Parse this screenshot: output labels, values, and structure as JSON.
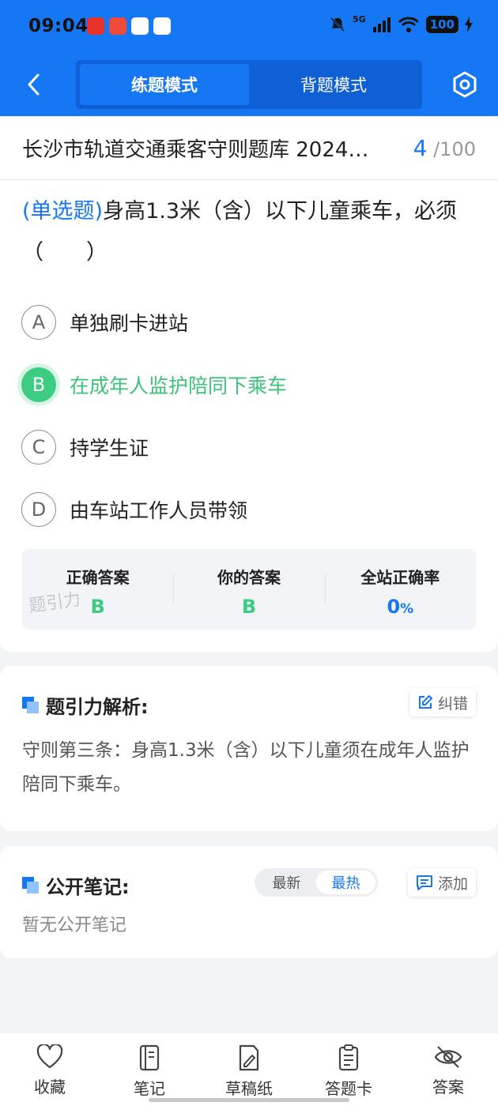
{
  "status_bar": {
    "time": "09:04",
    "network": "5G",
    "battery": "100"
  },
  "nav": {
    "modes": [
      "练题模式",
      "背题模式"
    ],
    "active_mode": "练题模式"
  },
  "question": {
    "bank_title": "长沙市轨道交通乘客守则题库 2024…",
    "current": "4",
    "total": "/100",
    "type_label": "(单选题)",
    "text": "身高1.3米（含）以下儿童乘车，必须（　　）",
    "options": [
      {
        "letter": "A",
        "text": "单独刷卡进站"
      },
      {
        "letter": "B",
        "text": "在成年人监护陪同下乘车"
      },
      {
        "letter": "C",
        "text": "持学生证"
      },
      {
        "letter": "D",
        "text": "由车站工作人员带领"
      }
    ],
    "selected": "B"
  },
  "answer": {
    "correct_label": "正确答案",
    "correct_value": "B",
    "yours_label": "你的答案",
    "yours_value": "B",
    "rate_label": "全站正确率",
    "rate_value": "0",
    "rate_unit": "%",
    "watermark": "题引力"
  },
  "analysis": {
    "title": "题引力解析:",
    "correct_btn": "纠错",
    "text": "守则第三条：身高1.3米（含）以下儿童须在成年人监护陪同下乘车。"
  },
  "notes": {
    "title": "公开笔记:",
    "sort_options": [
      "最新",
      "最热"
    ],
    "active_sort": "最热",
    "add_btn": "添加",
    "empty_text": "暂无公开笔记"
  },
  "bottom_bar": {
    "items": [
      {
        "label": "收藏",
        "icon": "heart-icon"
      },
      {
        "label": "笔记",
        "icon": "notebook-icon"
      },
      {
        "label": "草稿纸",
        "icon": "draft-icon"
      },
      {
        "label": "答题卡",
        "icon": "answer-card-icon"
      },
      {
        "label": "答案",
        "icon": "eye-off-icon"
      }
    ]
  },
  "colors": {
    "primary": "#1677f5",
    "correct": "#3ccd82"
  }
}
